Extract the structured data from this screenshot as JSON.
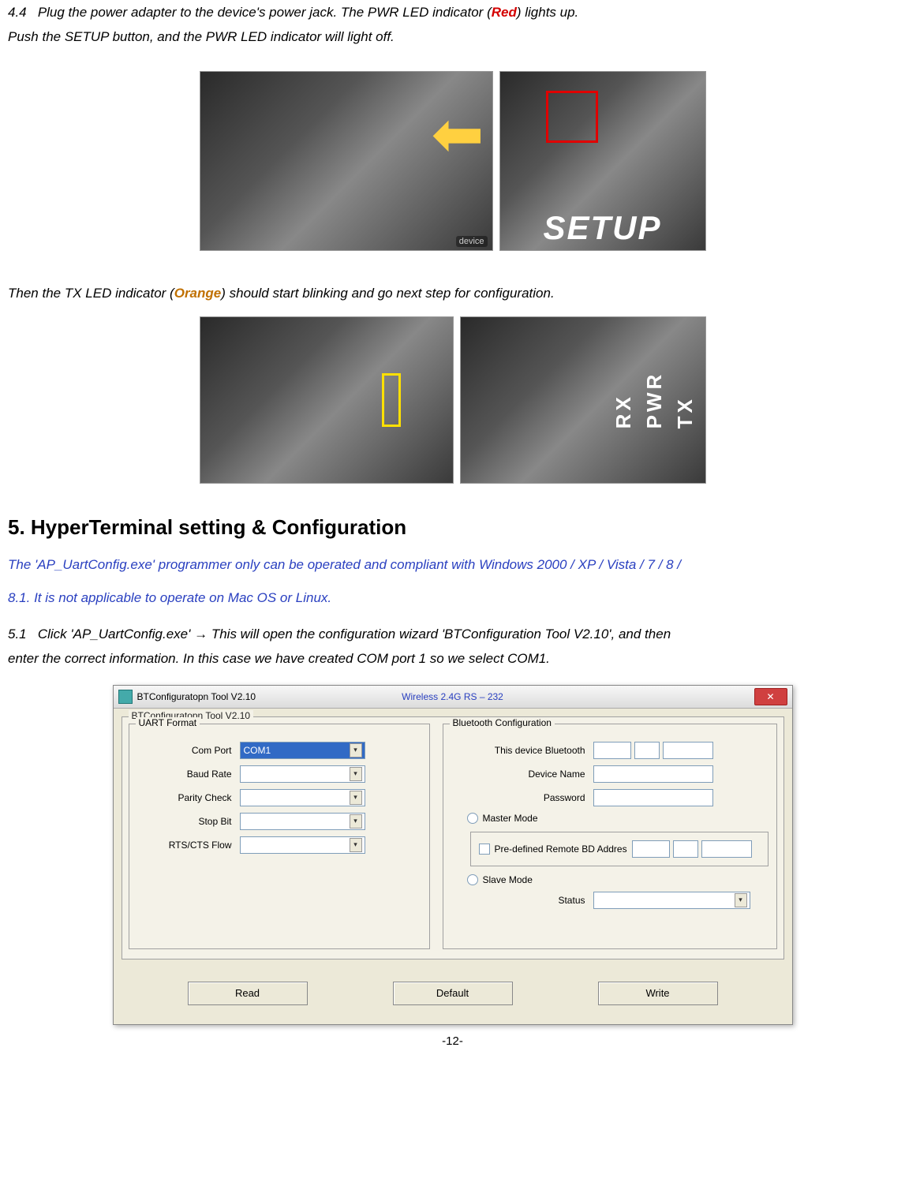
{
  "step44": {
    "num": "4.4",
    "text1_a": "Plug the power adapter to the device's power jack. The PWR LED indicator (",
    "red_word": "Red",
    "text1_b": ") lights up.",
    "text2": "Push the SETUP button, and the PWR LED indicator will light off."
  },
  "photos1": {
    "setup_overlay": "SETUP"
  },
  "between": {
    "text_a": "Then the TX LED indicator (",
    "orange_word": "Orange",
    "text_b": ") should start blinking and go next step for configuration."
  },
  "photos2": {
    "tx": "TX",
    "pwr": "PWR",
    "rx": "RX"
  },
  "section5": {
    "heading": "5. HyperTerminal setting & Configuration",
    "note_line1": "The 'AP_UartConfig.exe' programmer only can be operated and compliant with Windows 2000 / XP / Vista / 7 / 8 /",
    "note_line2": "8.1. It is not applicable to operate on Mac OS or Linux."
  },
  "step51": {
    "num": "5.1",
    "text_a": "Click 'AP_UartConfig.exe' ",
    "arrow": "→",
    "text_b": " This will open the configuration wizard 'BTConfiguration Tool V2.10', and then",
    "text_c": "enter the correct information. In this case we have created COM port 1 so we select COM1."
  },
  "window": {
    "title_left": "BTConfiguratopn Tool V2.10",
    "title_center": "Wireless 2.4G RS – 232",
    "group_legend": "BTConfiguratopn Tool V2.10",
    "uart": {
      "legend": "UART Format",
      "com_port_label": "Com Port",
      "com_port_value": "COM1",
      "baud_label": "Baud Rate",
      "parity_label": "Parity Check",
      "stop_label": "Stop Bit",
      "rtscts_label": "RTS/CTS Flow"
    },
    "bt": {
      "legend": "Bluetooth Configuration",
      "this_dev": "This device Bluetooth",
      "dev_name": "Device Name",
      "password": "Password",
      "master": "Master Mode",
      "predef": "Pre-defined Remote BD Addres",
      "slave": "Slave Mode",
      "status": "Status"
    },
    "buttons": {
      "read": "Read",
      "default": "Default",
      "write": "Write"
    }
  },
  "footer": "-12-"
}
